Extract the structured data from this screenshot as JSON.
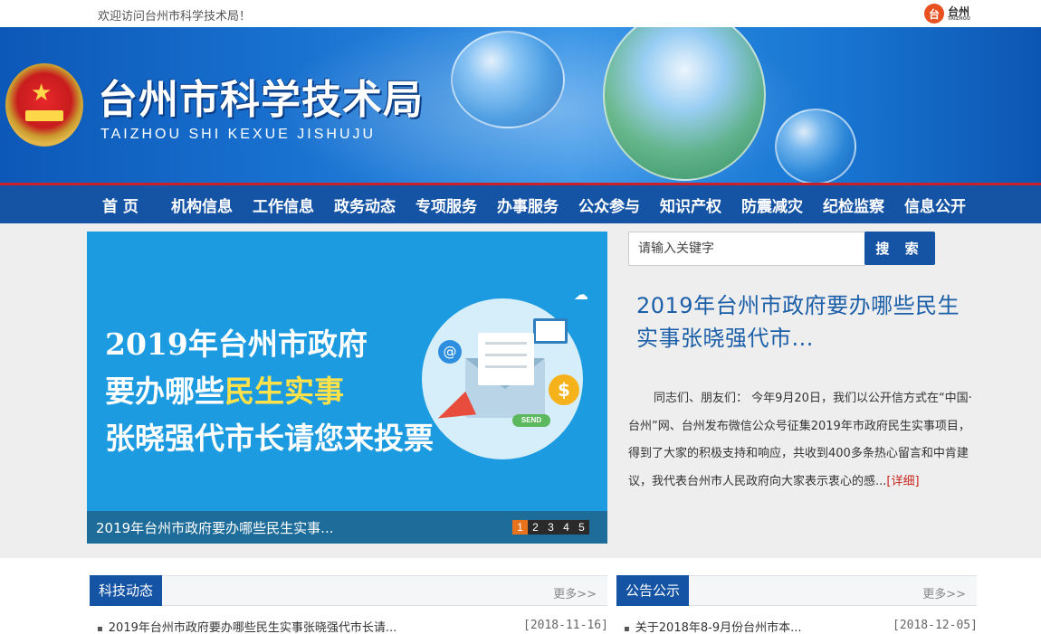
{
  "topbar": {
    "welcome": "欢迎访问台州市科学技术局！",
    "city_logo_text": "台州",
    "city_logo_sub": "TAIZHOU"
  },
  "banner": {
    "title": "台州市科学技术局",
    "subtitle": "TAIZHOU SHI KEXUE JISHUJU"
  },
  "nav": {
    "items": [
      "首 页",
      "机构信息",
      "工作信息",
      "政务动态",
      "专项服务",
      "办事服务",
      "公众参与",
      "知识产权",
      "防震减灾",
      "纪检监察",
      "信息公开"
    ]
  },
  "slider": {
    "line1": "2019年台州市政府",
    "line2_prefix": "要办哪些",
    "line2_highlight": "民生实事",
    "line3": "张晓强代市长请您来投票",
    "icon_coin": "$",
    "icon_at": "@",
    "icon_send": "SEND",
    "caption": "2019年台州市政府要办哪些民生实事...",
    "pages": [
      "1",
      "2",
      "3",
      "4",
      "5"
    ],
    "active_page": "1"
  },
  "search": {
    "placeholder": "请输入关键字",
    "button": "搜 索"
  },
  "featured": {
    "headline": "2019年台州市政府要办哪些民生实事张晓强代市...",
    "summary": "同志们、朋友们： 今年9月20日，我们以公开信方式在“中国·台州”网、台州发布微信公众号征集2019年市政府民生实事项目，得到了大家的积极支持和响应，共收到400多条热心留言和中肯建议，我代表台州市人民政府向大家表示衷心的感...",
    "more": "[详细]"
  },
  "sections": {
    "left": {
      "title": "科技动态",
      "more": "更多>>",
      "items": [
        {
          "text": "2019年台州市政府要办哪些民生实事张晓强代市长请...",
          "date": "[2018-11-16]"
        }
      ]
    },
    "right": {
      "title": "公告公示",
      "more": "更多>>",
      "items": [
        {
          "text": "关于2018年8-9月份台州市本...",
          "date": "[2018-12-05]"
        }
      ]
    }
  },
  "colors": {
    "nav_blue": "#1553a4",
    "accent_red": "#c9202a",
    "slide_blue": "#1d9be0",
    "headline_blue": "#1c5fa9",
    "active_dot": "#e8731c"
  }
}
